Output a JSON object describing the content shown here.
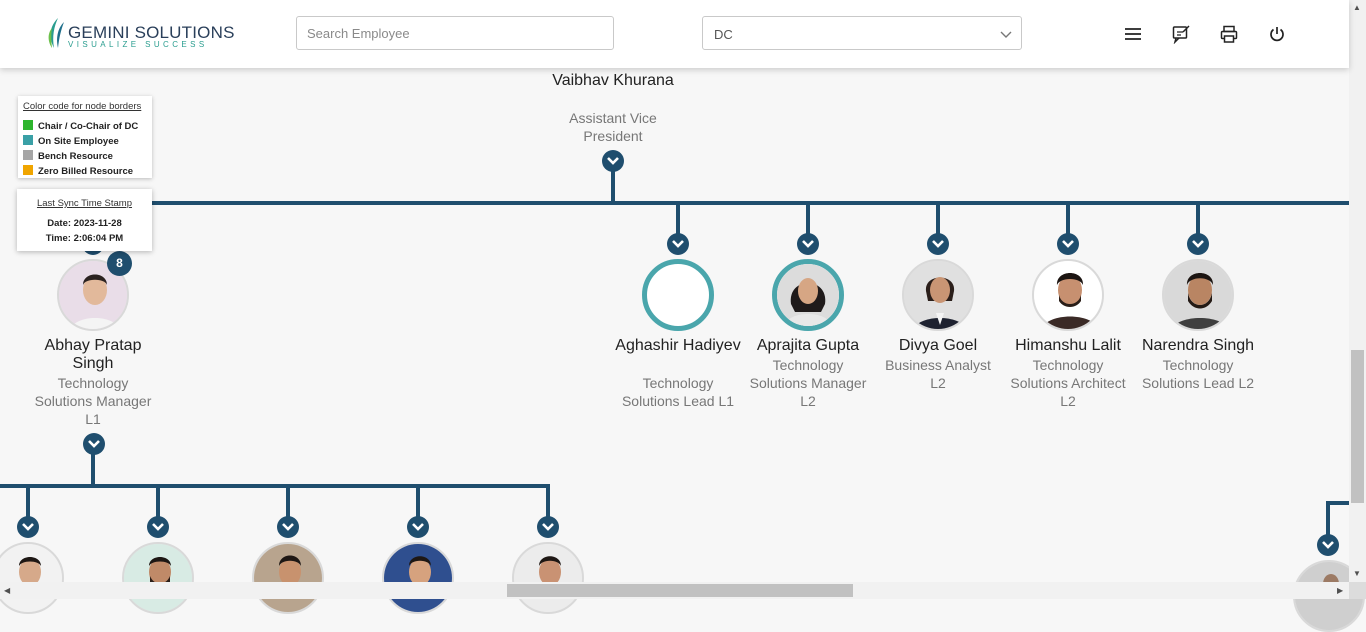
{
  "header": {
    "logo_title": "GEMINI SOLUTIONS",
    "logo_tagline": "VISUALIZE SUCCESS",
    "search_placeholder": "Search Employee",
    "search_value": "",
    "dc_select_value": "DC",
    "icons": [
      "menu-icon",
      "feedback-icon",
      "print-icon",
      "power-icon"
    ]
  },
  "legend": {
    "title": "Color code for node borders",
    "items": [
      {
        "label": "Chair / Co-Chair of DC",
        "color": "#2db52d"
      },
      {
        "label": "On Site Employee",
        "color": "#3aa0a6"
      },
      {
        "label": "Bench Resource",
        "color": "#a6a6a6"
      },
      {
        "label": "Zero Billed Resource",
        "color": "#f0a500"
      }
    ]
  },
  "sync": {
    "title": "Last Sync Time Stamp",
    "date": "Date: 2023-11-28",
    "time": "Time: 2:06:04 PM"
  },
  "colors": {
    "connector": "#1f4e6e",
    "onsite_border": "#4aa6ac"
  },
  "tree": {
    "root": {
      "name": "Vaibhav Khurana",
      "role": "Assistant Vice President"
    },
    "children": [
      {
        "name": "Abhay Pratap Singh",
        "role": "Technology Solutions Manager L1",
        "reports_count": "8"
      },
      {
        "name": "Aghashir Hadiyev",
        "role": "Technology Solutions Lead L1",
        "photo": "none"
      },
      {
        "name": "Aprajita Gupta",
        "role": "Technology Solutions Manager L2",
        "border": "On Site Employee"
      },
      {
        "name": "Divya Goel",
        "role": "Business Analyst L2"
      },
      {
        "name": "Himanshu Lalit",
        "role": "Technology Solutions Architect L2"
      },
      {
        "name": "Narendra Singh",
        "role": "Technology Solutions Lead L2"
      }
    ],
    "grandchildren_visible": 5
  }
}
